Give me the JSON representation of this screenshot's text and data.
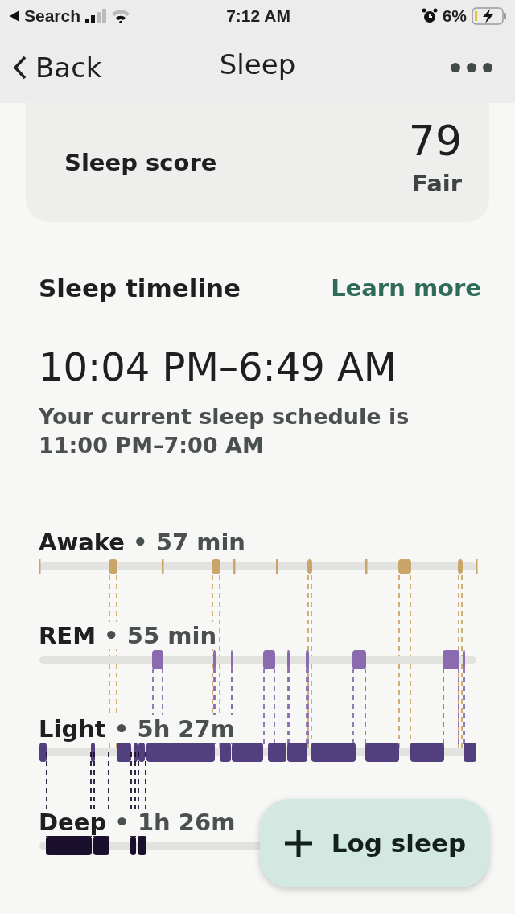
{
  "status_bar": {
    "back_app": "Search",
    "time": "7:12 AM",
    "battery": "6%"
  },
  "nav": {
    "back": "Back",
    "title": "Sleep"
  },
  "score_card": {
    "label": "Sleep score",
    "score": "79",
    "rating": "Fair"
  },
  "timeline": {
    "title": "Sleep timeline",
    "link": "Learn more",
    "range": "10:04 PM–6:49 AM",
    "schedule": "Your current sleep schedule is 11:00 PM–7:00 AM",
    "stages": [
      {
        "kind": "awake",
        "name": "Awake",
        "separator": "•",
        "duration": "57 min",
        "color": "#c9a56a"
      },
      {
        "kind": "rem",
        "name": "REM",
        "separator": "•",
        "duration": "55 min",
        "color": "#8a6bb0"
      },
      {
        "kind": "light",
        "name": "Light",
        "separator": "•",
        "duration": "5h 27m",
        "color": "#523f7e"
      },
      {
        "kind": "deep",
        "name": "Deep",
        "separator": "•",
        "duration": "1h 26m",
        "color": "#1a0f2e"
      }
    ]
  },
  "fab": {
    "label": "Log sleep"
  }
}
